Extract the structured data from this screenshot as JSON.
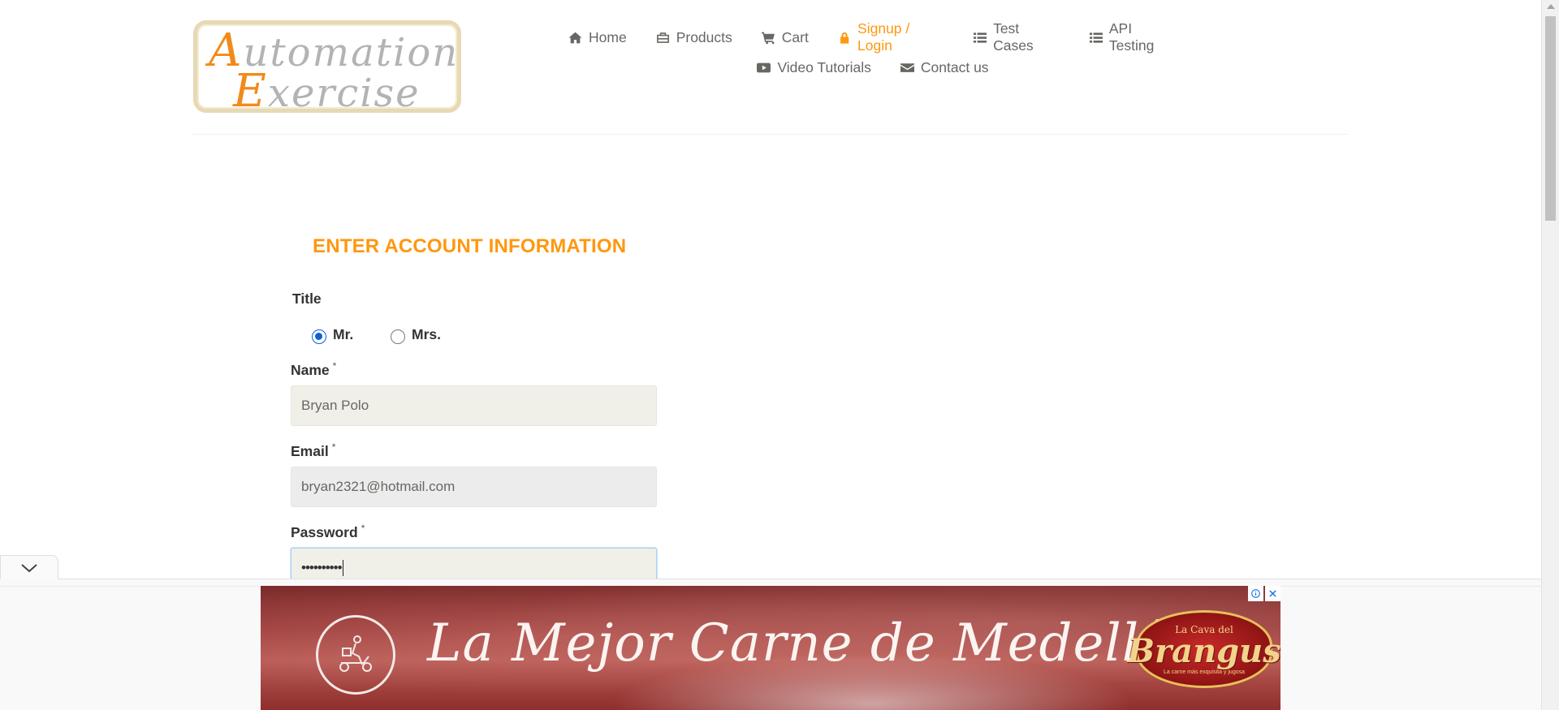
{
  "logo": {
    "line1_cap": "A",
    "line1_rest": "utomation",
    "line2_cap": "E",
    "line2_rest": "xercise"
  },
  "nav": {
    "row1": [
      {
        "label": "Home",
        "icon": "home-icon"
      },
      {
        "label": "Products",
        "icon": "briefcase-icon"
      },
      {
        "label": "Cart",
        "icon": "cart-icon"
      },
      {
        "label": "Signup / Login",
        "icon": "lock-icon",
        "active": true
      },
      {
        "label": "Test Cases",
        "icon": "list-icon"
      },
      {
        "label": "API Testing",
        "icon": "list-icon"
      }
    ],
    "row2": [
      {
        "label": "Video Tutorials",
        "icon": "youtube-icon"
      },
      {
        "label": "Contact us",
        "icon": "envelope-icon"
      }
    ]
  },
  "form": {
    "heading": "ENTER ACCOUNT INFORMATION",
    "title_label": "Title",
    "title_options": [
      {
        "label": "Mr.",
        "checked": true
      },
      {
        "label": "Mrs.",
        "checked": false
      }
    ],
    "name_label": "Name",
    "name_value": "Bryan Polo",
    "email_label": "Email",
    "email_value": "bryan2321@hotmail.com",
    "password_label": "Password",
    "password_value": "••••••••••",
    "required_mark": "*"
  },
  "ad": {
    "headline": "La Mejor Carne de Medellín",
    "brand_top": "La Cava del",
    "brand_main": "Brangus",
    "brand_sub": "La carne más exquisita y jugosa",
    "info_icon": "info-icon",
    "close_icon": "close-icon"
  },
  "colors": {
    "accent": "#fe980f",
    "nav_text": "#696763",
    "field_bg": "#f0f0e9"
  }
}
